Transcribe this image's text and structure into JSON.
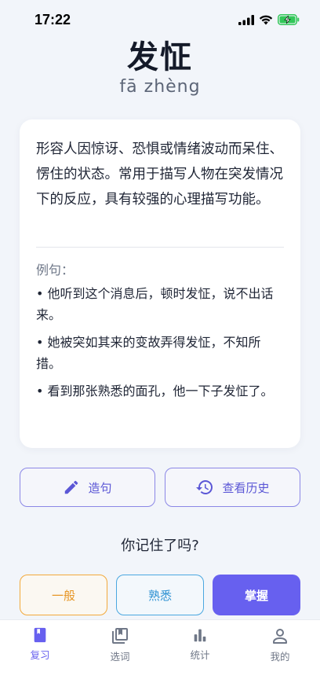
{
  "status": {
    "time": "17:22",
    "icons": [
      "signal-icon",
      "wifi-icon",
      "battery-charging-icon"
    ]
  },
  "word": {
    "hanzi": "发怔",
    "pinyin": "fā zhèng"
  },
  "card": {
    "definition": "形容人因惊讶、恐惧或情绪波动而呆住、愣住的状态。常用于描写人物在突发情况下的反应，具有较强的心理描写功能。",
    "examples_label": "例句：",
    "examples": [
      "• 他听到这个消息后，顿时发怔，说不出话来。",
      "• 她被突如其来的变故弄得发怔，不知所措。",
      "• 看到那张熟悉的面孔，他一下子发怔了。"
    ]
  },
  "actions": {
    "make_sentence": "造句",
    "view_history": "查看历史"
  },
  "question": "你记住了吗?",
  "rating": {
    "ok": "一般",
    "familiar": "熟悉",
    "master": "掌握"
  },
  "tabs": [
    {
      "label": "复习",
      "icon": "book-icon",
      "active": true
    },
    {
      "label": "选词",
      "icon": "library-icon",
      "active": false
    },
    {
      "label": "统计",
      "icon": "bar-chart-icon",
      "active": false
    },
    {
      "label": "我的",
      "icon": "person-icon",
      "active": false
    }
  ],
  "colors": {
    "accent": "#6760ef",
    "ok": "#f2a93b",
    "familiar": "#4aa7e0",
    "background": "#f2f5fa"
  }
}
